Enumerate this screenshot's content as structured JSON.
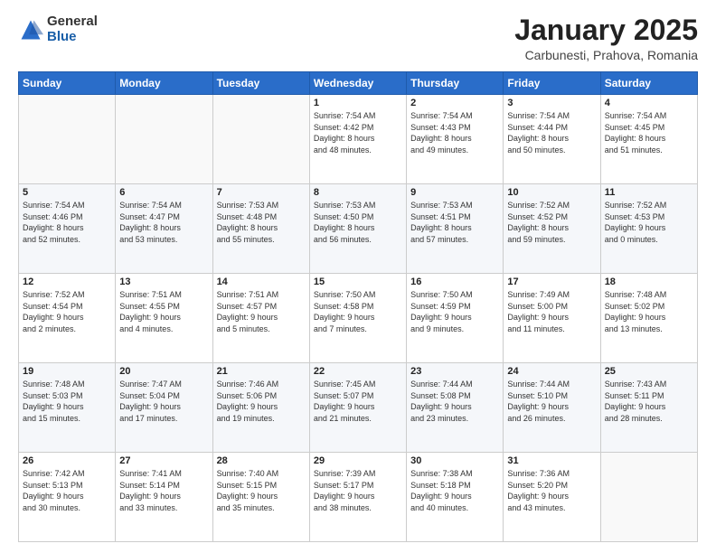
{
  "logo": {
    "general": "General",
    "blue": "Blue"
  },
  "title": "January 2025",
  "location": "Carbunesti, Prahova, Romania",
  "days_header": [
    "Sunday",
    "Monday",
    "Tuesday",
    "Wednesday",
    "Thursday",
    "Friday",
    "Saturday"
  ],
  "weeks": [
    [
      {
        "day": "",
        "info": ""
      },
      {
        "day": "",
        "info": ""
      },
      {
        "day": "",
        "info": ""
      },
      {
        "day": "1",
        "info": "Sunrise: 7:54 AM\nSunset: 4:42 PM\nDaylight: 8 hours\nand 48 minutes."
      },
      {
        "day": "2",
        "info": "Sunrise: 7:54 AM\nSunset: 4:43 PM\nDaylight: 8 hours\nand 49 minutes."
      },
      {
        "day": "3",
        "info": "Sunrise: 7:54 AM\nSunset: 4:44 PM\nDaylight: 8 hours\nand 50 minutes."
      },
      {
        "day": "4",
        "info": "Sunrise: 7:54 AM\nSunset: 4:45 PM\nDaylight: 8 hours\nand 51 minutes."
      }
    ],
    [
      {
        "day": "5",
        "info": "Sunrise: 7:54 AM\nSunset: 4:46 PM\nDaylight: 8 hours\nand 52 minutes."
      },
      {
        "day": "6",
        "info": "Sunrise: 7:54 AM\nSunset: 4:47 PM\nDaylight: 8 hours\nand 53 minutes."
      },
      {
        "day": "7",
        "info": "Sunrise: 7:53 AM\nSunset: 4:48 PM\nDaylight: 8 hours\nand 55 minutes."
      },
      {
        "day": "8",
        "info": "Sunrise: 7:53 AM\nSunset: 4:50 PM\nDaylight: 8 hours\nand 56 minutes."
      },
      {
        "day": "9",
        "info": "Sunrise: 7:53 AM\nSunset: 4:51 PM\nDaylight: 8 hours\nand 57 minutes."
      },
      {
        "day": "10",
        "info": "Sunrise: 7:52 AM\nSunset: 4:52 PM\nDaylight: 8 hours\nand 59 minutes."
      },
      {
        "day": "11",
        "info": "Sunrise: 7:52 AM\nSunset: 4:53 PM\nDaylight: 9 hours\nand 0 minutes."
      }
    ],
    [
      {
        "day": "12",
        "info": "Sunrise: 7:52 AM\nSunset: 4:54 PM\nDaylight: 9 hours\nand 2 minutes."
      },
      {
        "day": "13",
        "info": "Sunrise: 7:51 AM\nSunset: 4:55 PM\nDaylight: 9 hours\nand 4 minutes."
      },
      {
        "day": "14",
        "info": "Sunrise: 7:51 AM\nSunset: 4:57 PM\nDaylight: 9 hours\nand 5 minutes."
      },
      {
        "day": "15",
        "info": "Sunrise: 7:50 AM\nSunset: 4:58 PM\nDaylight: 9 hours\nand 7 minutes."
      },
      {
        "day": "16",
        "info": "Sunrise: 7:50 AM\nSunset: 4:59 PM\nDaylight: 9 hours\nand 9 minutes."
      },
      {
        "day": "17",
        "info": "Sunrise: 7:49 AM\nSunset: 5:00 PM\nDaylight: 9 hours\nand 11 minutes."
      },
      {
        "day": "18",
        "info": "Sunrise: 7:48 AM\nSunset: 5:02 PM\nDaylight: 9 hours\nand 13 minutes."
      }
    ],
    [
      {
        "day": "19",
        "info": "Sunrise: 7:48 AM\nSunset: 5:03 PM\nDaylight: 9 hours\nand 15 minutes."
      },
      {
        "day": "20",
        "info": "Sunrise: 7:47 AM\nSunset: 5:04 PM\nDaylight: 9 hours\nand 17 minutes."
      },
      {
        "day": "21",
        "info": "Sunrise: 7:46 AM\nSunset: 5:06 PM\nDaylight: 9 hours\nand 19 minutes."
      },
      {
        "day": "22",
        "info": "Sunrise: 7:45 AM\nSunset: 5:07 PM\nDaylight: 9 hours\nand 21 minutes."
      },
      {
        "day": "23",
        "info": "Sunrise: 7:44 AM\nSunset: 5:08 PM\nDaylight: 9 hours\nand 23 minutes."
      },
      {
        "day": "24",
        "info": "Sunrise: 7:44 AM\nSunset: 5:10 PM\nDaylight: 9 hours\nand 26 minutes."
      },
      {
        "day": "25",
        "info": "Sunrise: 7:43 AM\nSunset: 5:11 PM\nDaylight: 9 hours\nand 28 minutes."
      }
    ],
    [
      {
        "day": "26",
        "info": "Sunrise: 7:42 AM\nSunset: 5:13 PM\nDaylight: 9 hours\nand 30 minutes."
      },
      {
        "day": "27",
        "info": "Sunrise: 7:41 AM\nSunset: 5:14 PM\nDaylight: 9 hours\nand 33 minutes."
      },
      {
        "day": "28",
        "info": "Sunrise: 7:40 AM\nSunset: 5:15 PM\nDaylight: 9 hours\nand 35 minutes."
      },
      {
        "day": "29",
        "info": "Sunrise: 7:39 AM\nSunset: 5:17 PM\nDaylight: 9 hours\nand 38 minutes."
      },
      {
        "day": "30",
        "info": "Sunrise: 7:38 AM\nSunset: 5:18 PM\nDaylight: 9 hours\nand 40 minutes."
      },
      {
        "day": "31",
        "info": "Sunrise: 7:36 AM\nSunset: 5:20 PM\nDaylight: 9 hours\nand 43 minutes."
      },
      {
        "day": "",
        "info": ""
      }
    ]
  ]
}
